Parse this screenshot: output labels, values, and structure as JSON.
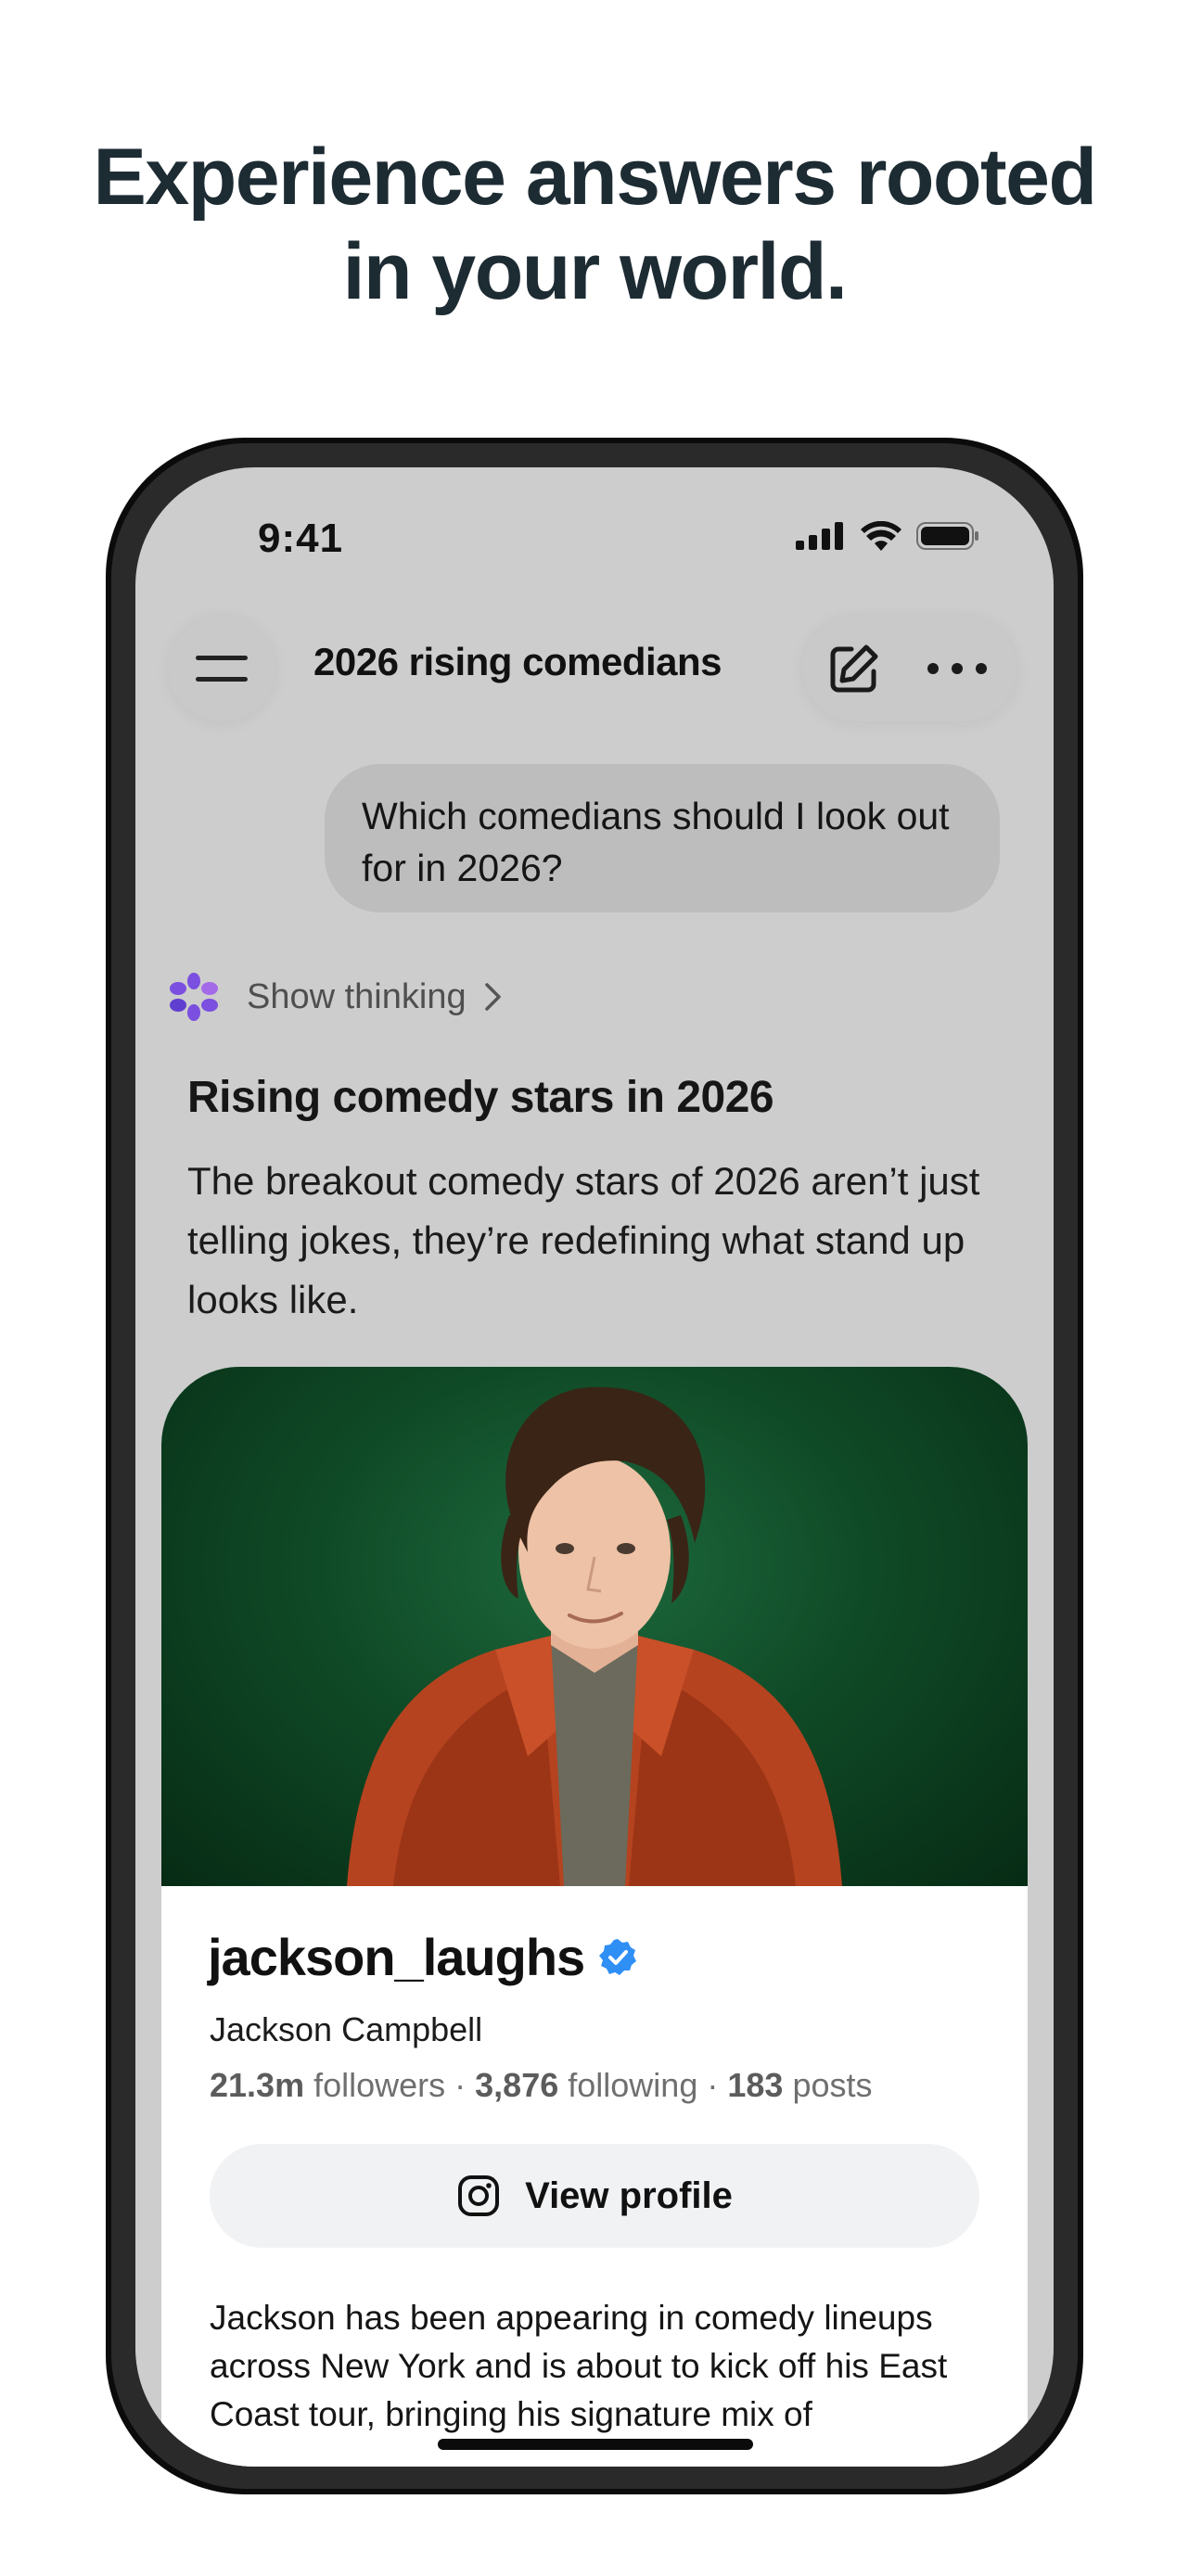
{
  "headline": {
    "line1": "Experience answers rooted",
    "line2": "in your world."
  },
  "status_bar": {
    "time": "9:41",
    "icons": [
      "signal-icon",
      "wifi-icon",
      "battery-icon"
    ]
  },
  "top_bar": {
    "title": "2026 rising comedians",
    "menu_icon": "hamburger-menu-icon",
    "edit_icon": "edit-icon",
    "more_icon": "more-icon"
  },
  "chat": {
    "user_message": "Which comedians should I look out for in 2026?",
    "thinking_label": "Show thinking",
    "answer_heading": "Rising comedy stars in 2026",
    "answer_body": "The breakout comedy stars of 2026 aren’t just telling jokes, they’re redefining what stand up looks like."
  },
  "profile_card": {
    "username": "jackson_laughs",
    "full_name": "Jackson Campbell",
    "followers_count": "21.3m",
    "followers_label": "followers",
    "following_count": "3,876",
    "following_label": "following",
    "posts_count": "183",
    "posts_label": "posts",
    "separator": " · ",
    "button_label": "View profile",
    "description": "Jackson has been appearing in comedy lineups across New York and is about to kick off his East Coast tour, bringing his signature mix of"
  },
  "colors": {
    "headline": "#1d2b33",
    "screen_bg": "#cdcdcd",
    "verified": "#2f8ff5",
    "thinking_icon": "#7b4fe0",
    "photo_bg": "#0f4a26",
    "jacket": "#b5431f"
  }
}
